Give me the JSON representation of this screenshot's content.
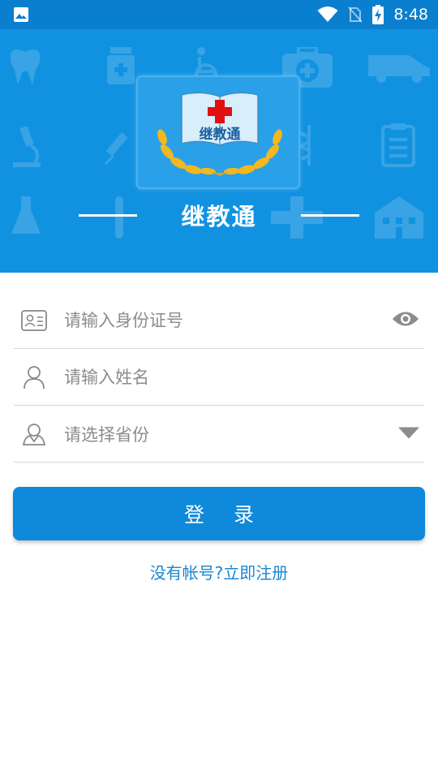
{
  "status_bar": {
    "time": "8:48",
    "icons": [
      "gallery-icon",
      "wifi-icon",
      "no-sim-icon",
      "battery-charging-icon"
    ]
  },
  "header": {
    "logo_text": "继教通",
    "app_title": "继教通",
    "background_icons": [
      "tooth-icon",
      "medicine-bottle-icon",
      "wheelchair-icon",
      "first-aid-kit-icon",
      "ambulance-icon",
      "microscope-icon",
      "syringe-icon",
      "caduceus-icon",
      "clipboard-icon",
      "flask-icon",
      "test-tube-icon",
      "cross-icon",
      "hospital-icon"
    ]
  },
  "form": {
    "id_number": {
      "placeholder": "请输入身份证号",
      "value": ""
    },
    "name": {
      "placeholder": "请输入姓名",
      "value": ""
    },
    "province": {
      "placeholder": "请选择省份"
    }
  },
  "login_button": "登录",
  "register_link": "没有帐号?立即注册",
  "colors": {
    "primary": "#1192e1",
    "button": "#0f89d9",
    "link": "#1a86d0",
    "logo_gold": "#f2b820",
    "logo_red": "#e01010"
  }
}
